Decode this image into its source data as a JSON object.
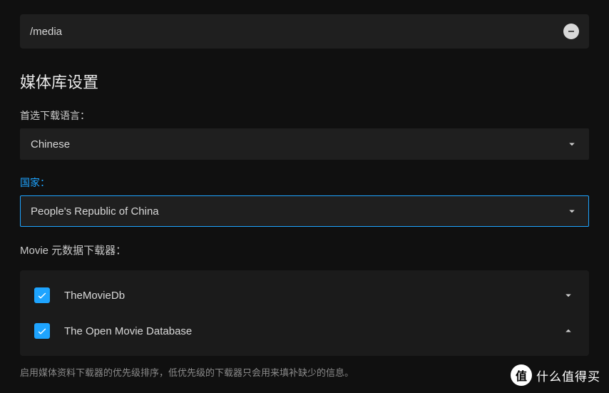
{
  "path": "/media",
  "section_title": "媒体库设置",
  "language": {
    "label": "首选下载语言：",
    "value": "Chinese"
  },
  "country": {
    "label": "国家：",
    "value": "People's Republic of China"
  },
  "downloaders": {
    "label": "Movie 元数据下载器：",
    "items": [
      {
        "name": "TheMovieDb",
        "checked": true,
        "expanded": false
      },
      {
        "name": "The Open Movie Database",
        "checked": true,
        "expanded": true
      }
    ],
    "help": "启用媒体资料下载器的优先级排序，低优先级的下载器只会用来填补缺少的信息。"
  },
  "watermark": {
    "badge": "值",
    "text": "什么值得买"
  }
}
